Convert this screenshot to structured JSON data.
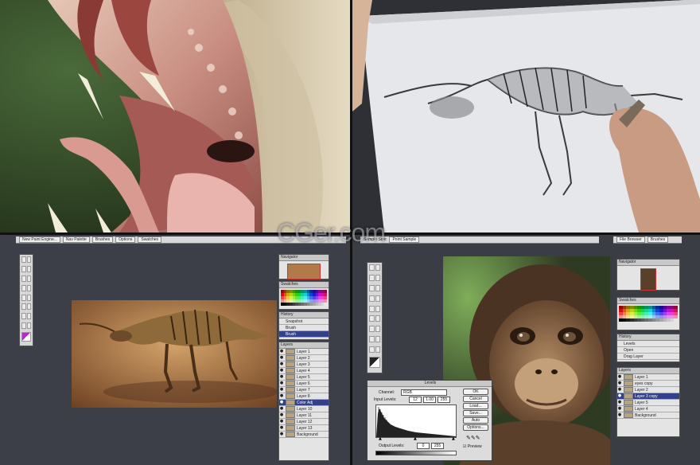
{
  "watermark": "CGer.com",
  "top_left": {
    "description_icon": "creature-mouth-painting"
  },
  "top_right": {
    "description_icon": "pencil-sketch-creature"
  },
  "bottom_left": {
    "menu_buttons": [
      "New Paint Engine...",
      "Nav Palette",
      "Brushes",
      "Options",
      "Swatches"
    ],
    "navigator_title": "Navigator",
    "swatches_title": "Swatches",
    "history_title": "History",
    "history_items": [
      "Snapshot",
      "Brush",
      "Brush",
      "Brush"
    ],
    "layers_title": "Layers",
    "layers": [
      "Layer 1",
      "Layer 2",
      "Layer 3",
      "Layer 4",
      "Layer 5",
      "Layer 6",
      "Layer 7",
      "Layer 8",
      "Color Adj",
      "Layer 10",
      "Layer 11",
      "Layer 12",
      "Layer 13",
      "Background"
    ]
  },
  "bottom_right": {
    "toolbar_items": [
      "Sample Size:",
      "Point Sample"
    ],
    "top_right_tabs": [
      "File Browser",
      "Brushes"
    ],
    "navigator_title": "Navigator",
    "swatches_title": "Swatches",
    "history_title": "History",
    "history_items": [
      "Levels",
      "Open",
      "Drag Layer"
    ],
    "layers_title": "Layers",
    "layers": [
      "Layer 1",
      "eyes copy",
      "Layer 2",
      "Layer 3 copy",
      "Layer 5",
      "Layer 4",
      "Background"
    ],
    "levels_dialog": {
      "title": "Levels",
      "channel_label": "Channel:",
      "channel_value": "RGB",
      "input_label": "Input Levels:",
      "input_values": [
        "12",
        "1.00",
        "255"
      ],
      "output_label": "Output Levels:",
      "output_values": [
        "0",
        "255"
      ],
      "buttons": [
        "OK",
        "Cancel",
        "Load...",
        "Save...",
        "Auto",
        "Options..."
      ],
      "preview_label": "Preview"
    }
  }
}
